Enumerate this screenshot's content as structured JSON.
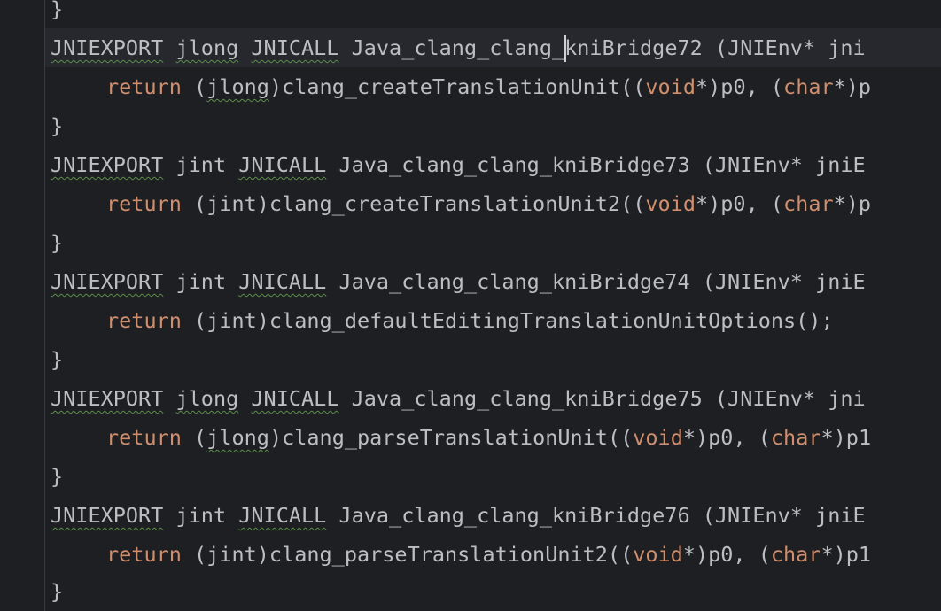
{
  "colors": {
    "background": "#1e1f22",
    "text": "#bcbec4",
    "keyword": "#cf8e6d",
    "warning_underline": "#5a8d4a",
    "current_line": "#26282e"
  },
  "lines": [
    {
      "text": "}"
    },
    {
      "parts": [
        "JNIEXPORT",
        "jlong",
        "JNICALL",
        "Java_clang_clang_",
        "kniBridge72 (JNIEnv* jni"
      ]
    },
    {
      "parts": [
        "return",
        "(",
        "jlong",
        ")clang_createTranslationUnit((",
        "void",
        "*)p0, (",
        "char",
        "*)p"
      ]
    },
    {
      "text": "}"
    },
    {
      "parts": [
        "JNIEXPORT",
        "jint",
        "JNICALL",
        "Java_clang_clang_kniBridge73 (JNIEnv* jniE"
      ]
    },
    {
      "parts": [
        "return",
        "(jint)clang_createTranslationUnit2((",
        "void",
        "*)p0, (",
        "char",
        "*)p"
      ]
    },
    {
      "text": "}"
    },
    {
      "parts": [
        "JNIEXPORT",
        "jint",
        "JNICALL",
        "Java_clang_clang_kniBridge74 (JNIEnv* jniE"
      ]
    },
    {
      "parts": [
        "return",
        "(jint)clang_defaultEditingTranslationUnitOptions();"
      ]
    },
    {
      "text": "}"
    },
    {
      "parts": [
        "JNIEXPORT",
        "jlong",
        "JNICALL",
        "Java_clang_clang_kniBridge75 (JNIEnv* jni"
      ]
    },
    {
      "parts": [
        "return",
        "(",
        "jlong",
        ")clang_parseTranslationUnit((",
        "void",
        "*)p0, (",
        "char",
        "*)p1"
      ]
    },
    {
      "text": "}"
    },
    {
      "parts": [
        "JNIEXPORT",
        "jint",
        "JNICALL",
        "Java_clang_clang_kniBridge76 (JNIEnv* jniE"
      ]
    },
    {
      "parts": [
        "return",
        "(jint)clang_parseTranslationUnit2((",
        "void",
        "*)p0, (",
        "char",
        "*)p1"
      ]
    },
    {
      "text": "}"
    }
  ]
}
